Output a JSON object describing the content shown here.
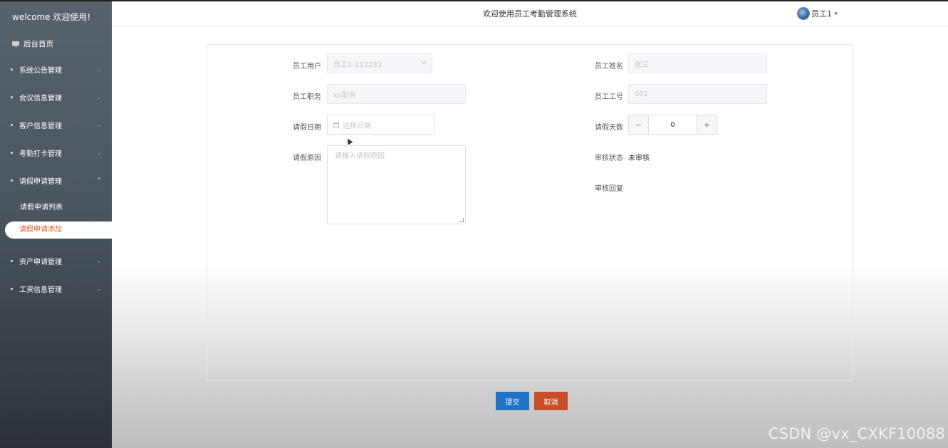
{
  "sidebar": {
    "welcome": "welcome 欢迎使用!",
    "home": "后台首页",
    "items": [
      {
        "label": "系统公告管理"
      },
      {
        "label": "会议信息管理"
      },
      {
        "label": "客户信息管理"
      },
      {
        "label": "考勤打卡管理"
      },
      {
        "label": "请假申请管理"
      },
      {
        "label": "资产申请管理"
      },
      {
        "label": "工资信息管理"
      }
    ],
    "sub_items": [
      {
        "label": "请假申请列表"
      },
      {
        "label": "请假申请添加"
      }
    ],
    "chevron_closed": "⌄",
    "chevron_open": "⌃"
  },
  "header": {
    "title": "欢迎使用员工考勤管理系统",
    "user": "员工1",
    "caret": "▾"
  },
  "form": {
    "employee_user_label": "员工用户",
    "employee_user_value": "员工1-112233",
    "employee_name_label": "员工姓名",
    "employee_name_value": "张三",
    "employee_position_label": "员工职务",
    "employee_position_value": "xx职务",
    "employee_number_label": "员工工号",
    "employee_number_value": "001",
    "leave_date_label": "请假日期",
    "leave_date_placeholder": "选择日期",
    "leave_days_label": "请假天数",
    "leave_days_value": "0",
    "minus": "−",
    "plus": "+",
    "leave_reason_label": "请假原因",
    "leave_reason_placeholder": "请输入请假原因",
    "review_status_label": "审核状态",
    "review_status_value": "未审核",
    "review_reply_label": "审核回复"
  },
  "actions": {
    "submit": "提交",
    "cancel": "取消"
  },
  "watermark": "CSDN @vx_CXKF10088",
  "colors": {
    "accent": "#e05e37",
    "submit": "#1f74c5",
    "cancel": "#c94e2a"
  }
}
